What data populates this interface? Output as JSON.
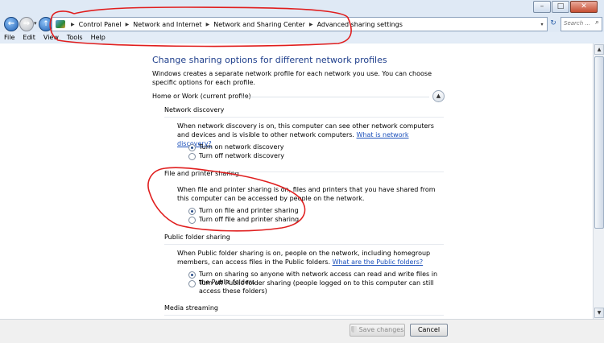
{
  "window": {
    "minimize": "–",
    "maximize": "□",
    "close": "✕"
  },
  "toolbar": {
    "breadcrumbs": [
      "Control Panel",
      "Network and Internet",
      "Network and Sharing Center",
      "Advanced sharing settings"
    ],
    "search_placeholder": "Search ...",
    "back_glyph": "←",
    "forward_glyph": "→",
    "up_glyph": "↑"
  },
  "menu": [
    "File",
    "Edit",
    "View",
    "Tools",
    "Help"
  ],
  "page": {
    "title": "Change sharing options for different network profiles",
    "intro": "Windows creates a separate network profile for each network you use. You can choose specific options for each profile.",
    "profile": "Home or Work (current profile)",
    "sections": {
      "discovery": {
        "title": "Network discovery",
        "desc": "When network discovery is on, this computer can see other network computers and devices and is visible to other network computers. ",
        "link": "What is network discovery?",
        "options": [
          "Turn on network discovery",
          "Turn off network discovery"
        ],
        "selected": 0
      },
      "fileprint": {
        "title": "File and printer sharing",
        "desc": "When file and printer sharing is on, files and printers that you have shared from this computer can be accessed by people on the network.",
        "options": [
          "Turn on file and printer sharing",
          "Turn off file and printer sharing"
        ],
        "selected": 0
      },
      "public": {
        "title": "Public folder sharing",
        "desc": "When Public folder sharing is on, people on the network, including homegroup members, can access files in the Public folders. ",
        "link": "What are the Public folders?",
        "options": [
          "Turn on sharing so anyone with network access can read and write files in the Public folders",
          "Turn off Public folder sharing (people logged on to this computer can still access these folders)"
        ],
        "selected": 0
      },
      "media": {
        "title": "Media streaming"
      }
    }
  },
  "footer": {
    "save": "Save changes",
    "cancel": "Cancel"
  },
  "annotation_color": "#e01e1e"
}
